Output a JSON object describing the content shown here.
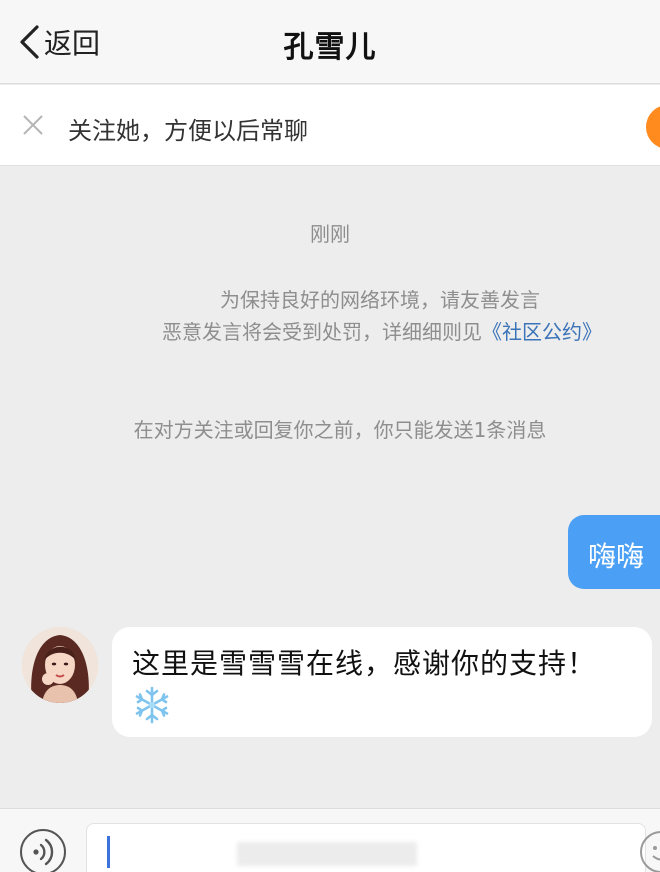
{
  "header": {
    "back_label": "返回",
    "title": "孔雪儿"
  },
  "follow_bar": {
    "text": "关注她，方便以后常聊",
    "close_icon": "close-icon",
    "accent_color": "#ff8a1e"
  },
  "chat": {
    "timestamp": "刚刚",
    "notice_line1": "为保持良好的网络环境，请友善发言",
    "notice_line2": "恶意发言将会受到处罚，详细细则见",
    "notice_link": "《社区公约》",
    "limit_notice": "在对方关注或回复你之前，你只能发送1条消息",
    "messages": [
      {
        "side": "out",
        "text": "嗨嗨",
        "color": "#4ba0f5"
      },
      {
        "side": "in",
        "text": "这里是雪雪雪在线，感谢你的支持！",
        "emoji": "snowflake-icon"
      }
    ]
  },
  "input_bar": {
    "voice_icon": "voice-icon",
    "emoji_icon": "emoji-icon"
  }
}
